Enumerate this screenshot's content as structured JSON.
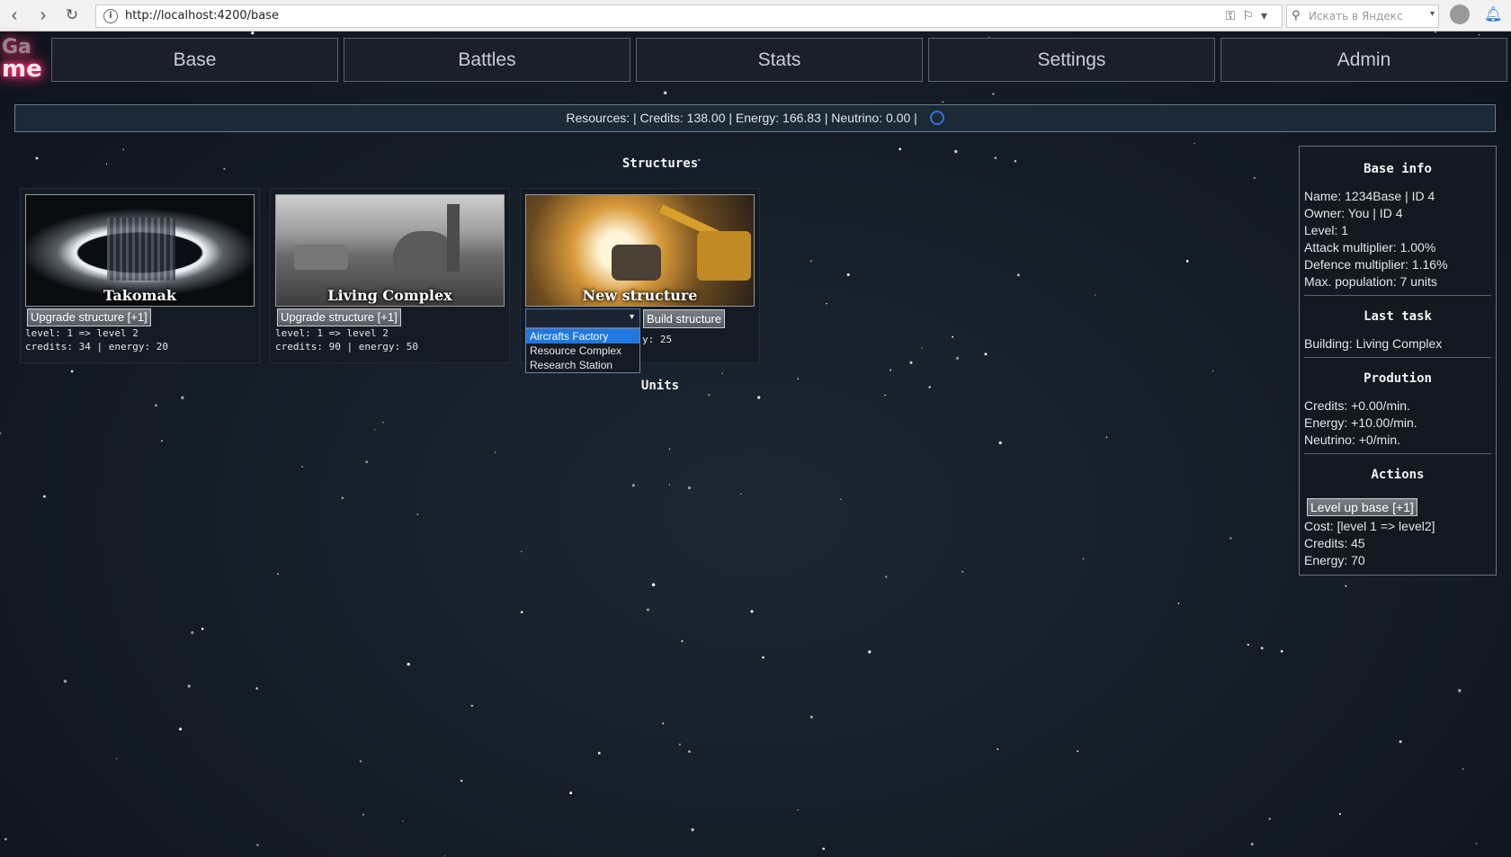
{
  "browser": {
    "url": "http://localhost:4200/base",
    "search_placeholder": "Искать в Яндекс"
  },
  "logo": {
    "line1": "Ga",
    "line2": "me"
  },
  "nav": {
    "items": [
      {
        "label": "Base"
      },
      {
        "label": "Battles"
      },
      {
        "label": "Stats"
      },
      {
        "label": "Settings"
      },
      {
        "label": "Admin"
      }
    ]
  },
  "resources": {
    "text": "Resources: | Credits: 138.00 | Energy: 166.83 | Neutrino: 0.00 |"
  },
  "structures": {
    "heading": "Structures",
    "items": [
      {
        "name": "Takomak",
        "upgrade_label": "Upgrade structure [+1]",
        "level_text": "level: 1 => level 2",
        "cost_text": "credits: 34 | energy: 20"
      },
      {
        "name": "Living Complex",
        "upgrade_label": "Upgrade structure [+1]",
        "level_text": "level: 1 => level 2",
        "cost_text": "credits: 90 | energy: 50"
      }
    ],
    "new_structure": {
      "name": "New structure",
      "build_label": "Build structure",
      "partial_text": "y: 25",
      "options": [
        "Aircrafts Factory",
        "Resource Complex",
        "Research Station"
      ],
      "highlighted_option": "Aircrafts Factory"
    }
  },
  "units": {
    "heading": "Units"
  },
  "base_info": {
    "heading": "Base info",
    "name": "Name: 1234Base | ID 4",
    "owner": "Owner: You | ID 4",
    "level": "Level: 1",
    "attack": "Attack multiplier: 1.00%",
    "defence": "Defence multiplier: 1.16%",
    "population": "Max. population: 7 units",
    "last_task_heading": "Last task",
    "last_task": "Building: Living Complex",
    "production_heading": "Prodution",
    "credits": "Credits: +0.00/min.",
    "energy": "Energy: +10.00/min.",
    "neutrino": "Neutrino: +0/min.",
    "actions_heading": "Actions",
    "level_up_label": "Level up base [+1]",
    "cost": "Cost: [level 1 => level2]",
    "cost_credits": "Credits: 45",
    "cost_energy": "Energy: 70"
  }
}
